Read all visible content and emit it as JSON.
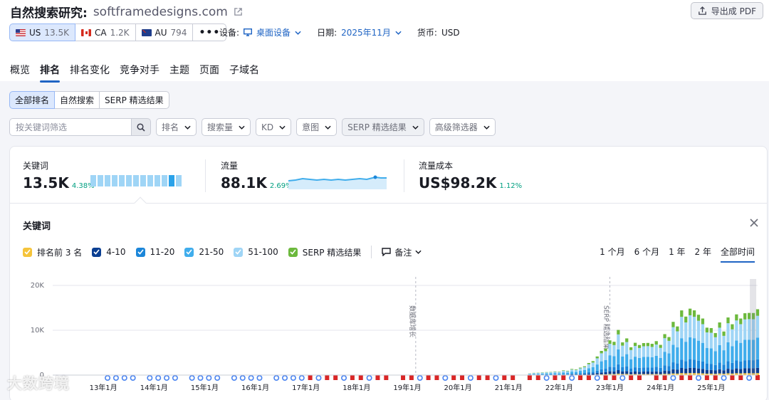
{
  "header": {
    "title_prefix": "自然搜索研究:",
    "domain": "softframedesigns.com",
    "export_label": "导出成 PDF"
  },
  "databases": [
    {
      "code": "US",
      "count": "13.5K"
    },
    {
      "code": "CA",
      "count": "1.2K"
    },
    {
      "code": "AU",
      "count": "794"
    }
  ],
  "more_label": "•••",
  "device": {
    "label": "设备:",
    "value": "桌面设备"
  },
  "date": {
    "label": "日期:",
    "value": "2025年11月"
  },
  "currency": {
    "label": "货币:",
    "value": "USD"
  },
  "tabs": [
    "概览",
    "排名",
    "排名变化",
    "竞争对手",
    "主题",
    "页面",
    "子域名"
  ],
  "segments": [
    "全部排名",
    "自然搜索",
    "SERP 精选结果"
  ],
  "search": {
    "placeholder": "按关键词筛选"
  },
  "filters": [
    "排名",
    "搜索量",
    "KD",
    "意图",
    "SERP 精选结果",
    "高级筛选器"
  ],
  "metrics": {
    "keywords": {
      "label": "关键词",
      "value": "13.5K",
      "change": "4.38%"
    },
    "traffic": {
      "label": "流量",
      "value": "88.1K",
      "change": "2.69%"
    },
    "cost": {
      "label": "流量成本",
      "value": "US$98.2K",
      "change": "1.12%"
    }
  },
  "panel_title": "关键词",
  "legend": [
    {
      "label": "排名前 3 名",
      "color": "#f5c43b"
    },
    {
      "label": "4-10",
      "color": "#0b3f92"
    },
    {
      "label": "11-20",
      "color": "#1c86d9"
    },
    {
      "label": "21-50",
      "color": "#40adec"
    },
    {
      "label": "51-100",
      "color": "#9fd5f6"
    },
    {
      "label": "SERP 精选结果",
      "color": "#6cb93d"
    }
  ],
  "notes_label": "备注",
  "ranges": [
    "1 个月",
    "6 个月",
    "1 年",
    "2 年",
    "全部时间"
  ],
  "watermark": "大数跨境",
  "chart_data": {
    "type": "bar",
    "stacked": true,
    "yticks": [
      "20K",
      "10K",
      "0"
    ],
    "ylim": [
      0,
      20000
    ],
    "xticks": [
      "13年1月",
      "14年1月",
      "15年1月",
      "16年1月",
      "17年1月",
      "18年1月",
      "19年1月",
      "20年1月",
      "21年1月",
      "22年1月",
      "23年1月",
      "24年1月",
      "25年1月"
    ],
    "annotations": [
      {
        "label": "数据库增长",
        "date": "2019-03"
      },
      {
        "label": "SERP 精选结果",
        "date": "2023-01"
      }
    ],
    "series": [
      {
        "name": "排名前 3 名",
        "color": "#f5c43b"
      },
      {
        "name": "4-10",
        "color": "#0b3f92"
      },
      {
        "name": "11-20",
        "color": "#1c86d9"
      },
      {
        "name": "21-50",
        "color": "#40adec"
      },
      {
        "name": "51-100",
        "color": "#9fd5f6"
      },
      {
        "name": "SERP 精选结果",
        "color": "#6cb93d"
      }
    ],
    "totals_approx": [
      {
        "date": "2021-06",
        "value": 400
      },
      {
        "date": "2022-01",
        "value": 800
      },
      {
        "date": "2022-06",
        "value": 1500
      },
      {
        "date": "2022-09",
        "value": 3000
      },
      {
        "date": "2023-03",
        "value": 9000
      },
      {
        "date": "2023-06",
        "value": 6500
      },
      {
        "date": "2024-01",
        "value": 7000
      },
      {
        "date": "2024-06",
        "value": 13000
      },
      {
        "date": "2024-09",
        "value": 14000
      },
      {
        "date": "2025-01",
        "value": 9500
      },
      {
        "date": "2025-06",
        "value": 12000
      },
      {
        "date": "2025-11",
        "value": 13500
      }
    ]
  }
}
